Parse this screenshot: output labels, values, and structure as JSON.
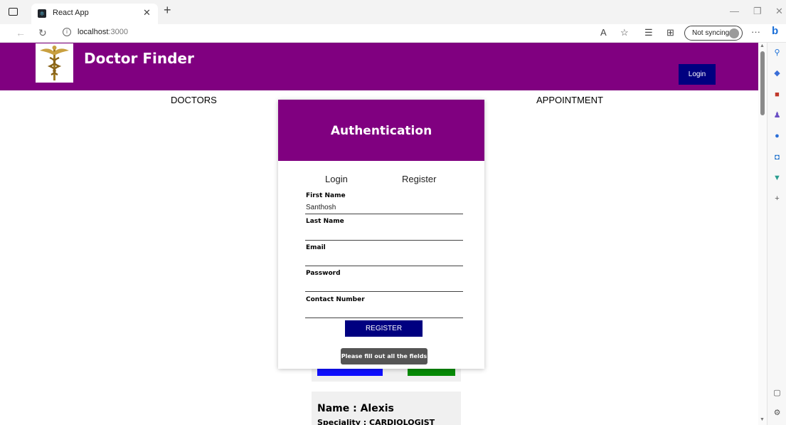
{
  "browser": {
    "tab_title": "React App",
    "url_host": "localhost",
    "url_port": ":3000",
    "sync_label": "Not syncing"
  },
  "site": {
    "title": "Doctor Finder",
    "header_login": "Login",
    "nav_doctors": "DOCTORS",
    "nav_appointment": "APPOINTMENT"
  },
  "modal": {
    "title": "Authentication",
    "tab_login": "Login",
    "tab_register": "Register",
    "fields": [
      {
        "label": "First Name",
        "value": "Santhosh"
      },
      {
        "label": "Last Name",
        "value": ""
      },
      {
        "label": "Email",
        "value": ""
      },
      {
        "label": "Password",
        "value": ""
      },
      {
        "label": "Contact Number",
        "value": ""
      }
    ],
    "register_button": "REGISTER",
    "tooltip": "Please fill out all the fields"
  },
  "doctor": {
    "name": "Name : Alexis",
    "speciality": "Speciality : CARDIOLOGIST"
  },
  "colors": {
    "brand_purple": "#800080",
    "navy": "#000080"
  }
}
